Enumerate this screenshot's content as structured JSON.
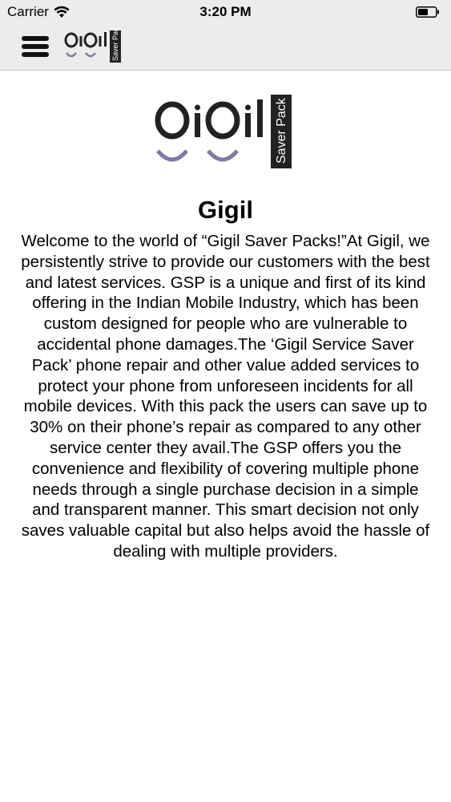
{
  "status_bar": {
    "carrier": "Carrier",
    "time": "3:20 PM"
  },
  "nav": {
    "menu_icon": "hamburger-menu-icon"
  },
  "logo": {
    "brand_text": "OiOil",
    "side_text": "Saver Pack",
    "accent_color": "#7f7aa5",
    "text_color": "#222222"
  },
  "main": {
    "title": "Gigil",
    "body": "Welcome to the world of “Gigil Saver Packs!”At Gigil, we persistently strive to provide our customers with the best and latest services. GSP is a unique and first of its kind offering in the Indian Mobile Industry, which has been custom designed for people who are vulnerable to accidental phone damages.The ‘Gigil Service Saver Pack’ phone repair and other value added services to protect your phone from unforeseen incidents for all mobile devices. With this pack the users can save up to 30% on their phone’s repair as compared to any other service center they avail.The GSP offers you the convenience and flexibility of covering multiple phone needs through a single purchase decision in a simple and transparent manner. This smart decision not only saves valuable capital but also helps avoid the hassle of dealing with multiple providers."
  }
}
